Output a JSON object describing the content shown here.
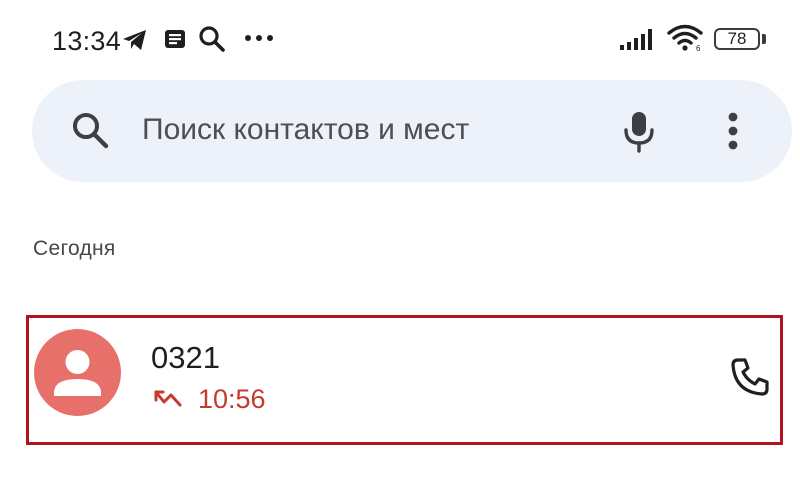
{
  "status_bar": {
    "time": "13:34",
    "icons": [
      "telegram-icon",
      "news-icon",
      "search-icon",
      "more-dots-icon",
      "signal-icon",
      "wifi-icon",
      "battery-icon"
    ],
    "battery_level": "78"
  },
  "search": {
    "placeholder": "Поиск контактов и мест",
    "icons": [
      "search-icon",
      "mic-icon",
      "more-vert-icon"
    ]
  },
  "call_log": {
    "section_header": "Сегодня",
    "entries": [
      {
        "name": "0321",
        "time": "10:56",
        "call_type": "missed",
        "call_type_icon": "missed-call-icon",
        "action_icon": "phone-icon"
      }
    ]
  },
  "colors": {
    "search_bg": "#edf1f9",
    "avatar_bg": "#e8706b",
    "missed_red": "#c5392f",
    "highlight_border": "#b3141c"
  }
}
